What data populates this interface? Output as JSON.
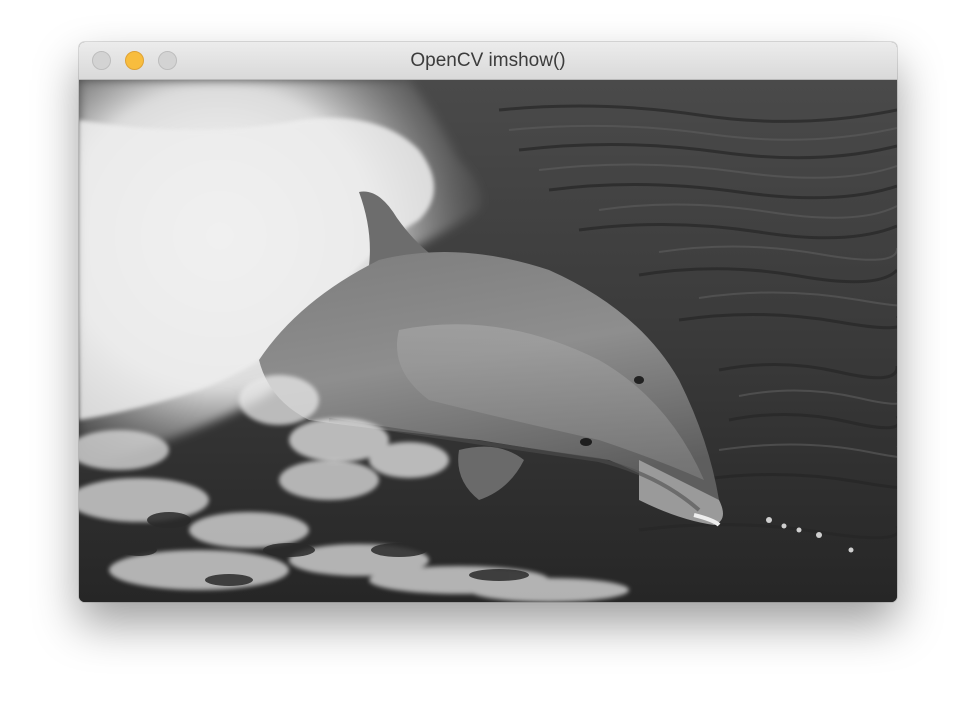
{
  "window": {
    "title": "OpenCV imshow()",
    "controls": {
      "close": {
        "icon": "close-traffic-light",
        "color": "#d3d3d3"
      },
      "minimize": {
        "icon": "minimize-traffic-light",
        "color": "#f8bd3e"
      },
      "zoom": {
        "icon": "zoom-traffic-light",
        "color": "#d3d3d3"
      }
    }
  },
  "image": {
    "subject": "grayscale-dolphin-photo",
    "color_mode": "grayscale"
  }
}
